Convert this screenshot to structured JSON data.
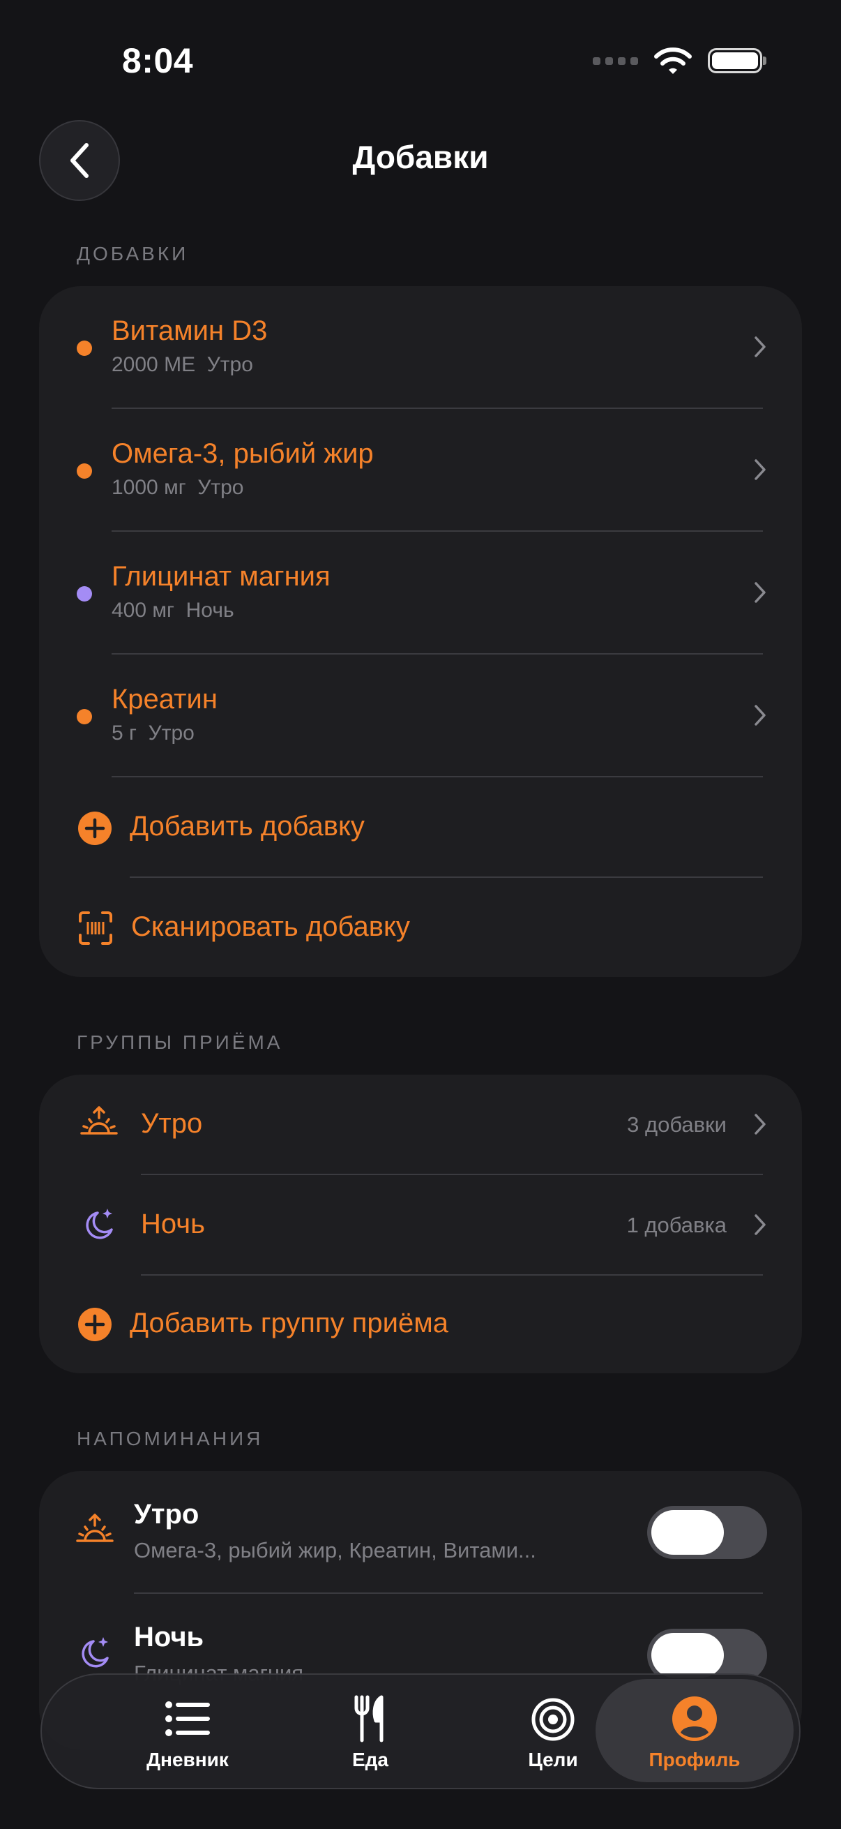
{
  "status": {
    "time": "8:04"
  },
  "header": {
    "title": "Добавки"
  },
  "supplements": {
    "section_title": "ДОБАВКИ",
    "items": [
      {
        "name": "Витамин D3",
        "dose": "2000 МЕ",
        "group": "Утро",
        "dot_color": "#f5822a"
      },
      {
        "name": "Омега-3, рыбий жир",
        "dose": "1000 мг",
        "group": "Утро",
        "dot_color": "#f5822a"
      },
      {
        "name": "Глицинат магния",
        "dose": "400 мг",
        "group": "Ночь",
        "dot_color": "#a48cf5"
      },
      {
        "name": "Креатин",
        "dose": "5 г",
        "group": "Утро",
        "dot_color": "#f5822a"
      }
    ],
    "add_label": "Добавить добавку",
    "scan_label": "Сканировать добавку"
  },
  "groups": {
    "section_title": "ГРУППЫ ПРИЁМА",
    "items": [
      {
        "name": "Утро",
        "count": "3 добавки",
        "icon": "sunrise-icon"
      },
      {
        "name": "Ночь",
        "count": "1 добавка",
        "icon": "moon-stars-icon"
      }
    ],
    "add_label": "Добавить группу приёма"
  },
  "reminders": {
    "section_title": "НАПОМИНАНИЯ",
    "items": [
      {
        "title": "Утро",
        "subtitle": "Омега-3, рыбий жир, Креатин, Витами...",
        "enabled": false,
        "icon": "sunrise-icon"
      },
      {
        "title": "Ночь",
        "subtitle": "Глицинат магния",
        "enabled": false,
        "icon": "moon-stars-icon"
      }
    ]
  },
  "tabbar": {
    "tabs": [
      {
        "label": "Дневник",
        "icon": "list-icon",
        "active": false
      },
      {
        "label": "Еда",
        "icon": "fork-knife-icon",
        "active": false
      },
      {
        "label": "Цели",
        "icon": "target-icon",
        "active": false
      },
      {
        "label": "Профиль",
        "icon": "person-icon",
        "active": true
      }
    ]
  },
  "colors": {
    "accent": "#f5822a",
    "night": "#a48cf5",
    "background": "#141417",
    "card": "#1e1e21"
  }
}
